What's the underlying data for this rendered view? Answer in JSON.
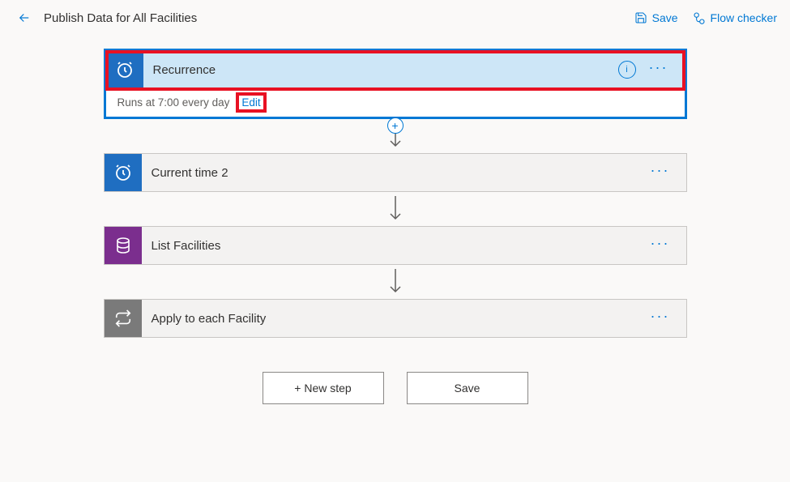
{
  "header": {
    "title": "Publish Data for All Facilities",
    "save_label": "Save",
    "flow_checker_label": "Flow checker"
  },
  "recurrence": {
    "title": "Recurrence",
    "schedule_text": "Runs at 7:00 every day",
    "edit_label": "Edit"
  },
  "steps": {
    "current_time": {
      "title": "Current time 2"
    },
    "list_facilities": {
      "title": "List Facilities"
    },
    "apply_each": {
      "title": "Apply to each Facility"
    }
  },
  "footer": {
    "new_step_label": "+ New step",
    "save_label": "Save"
  }
}
